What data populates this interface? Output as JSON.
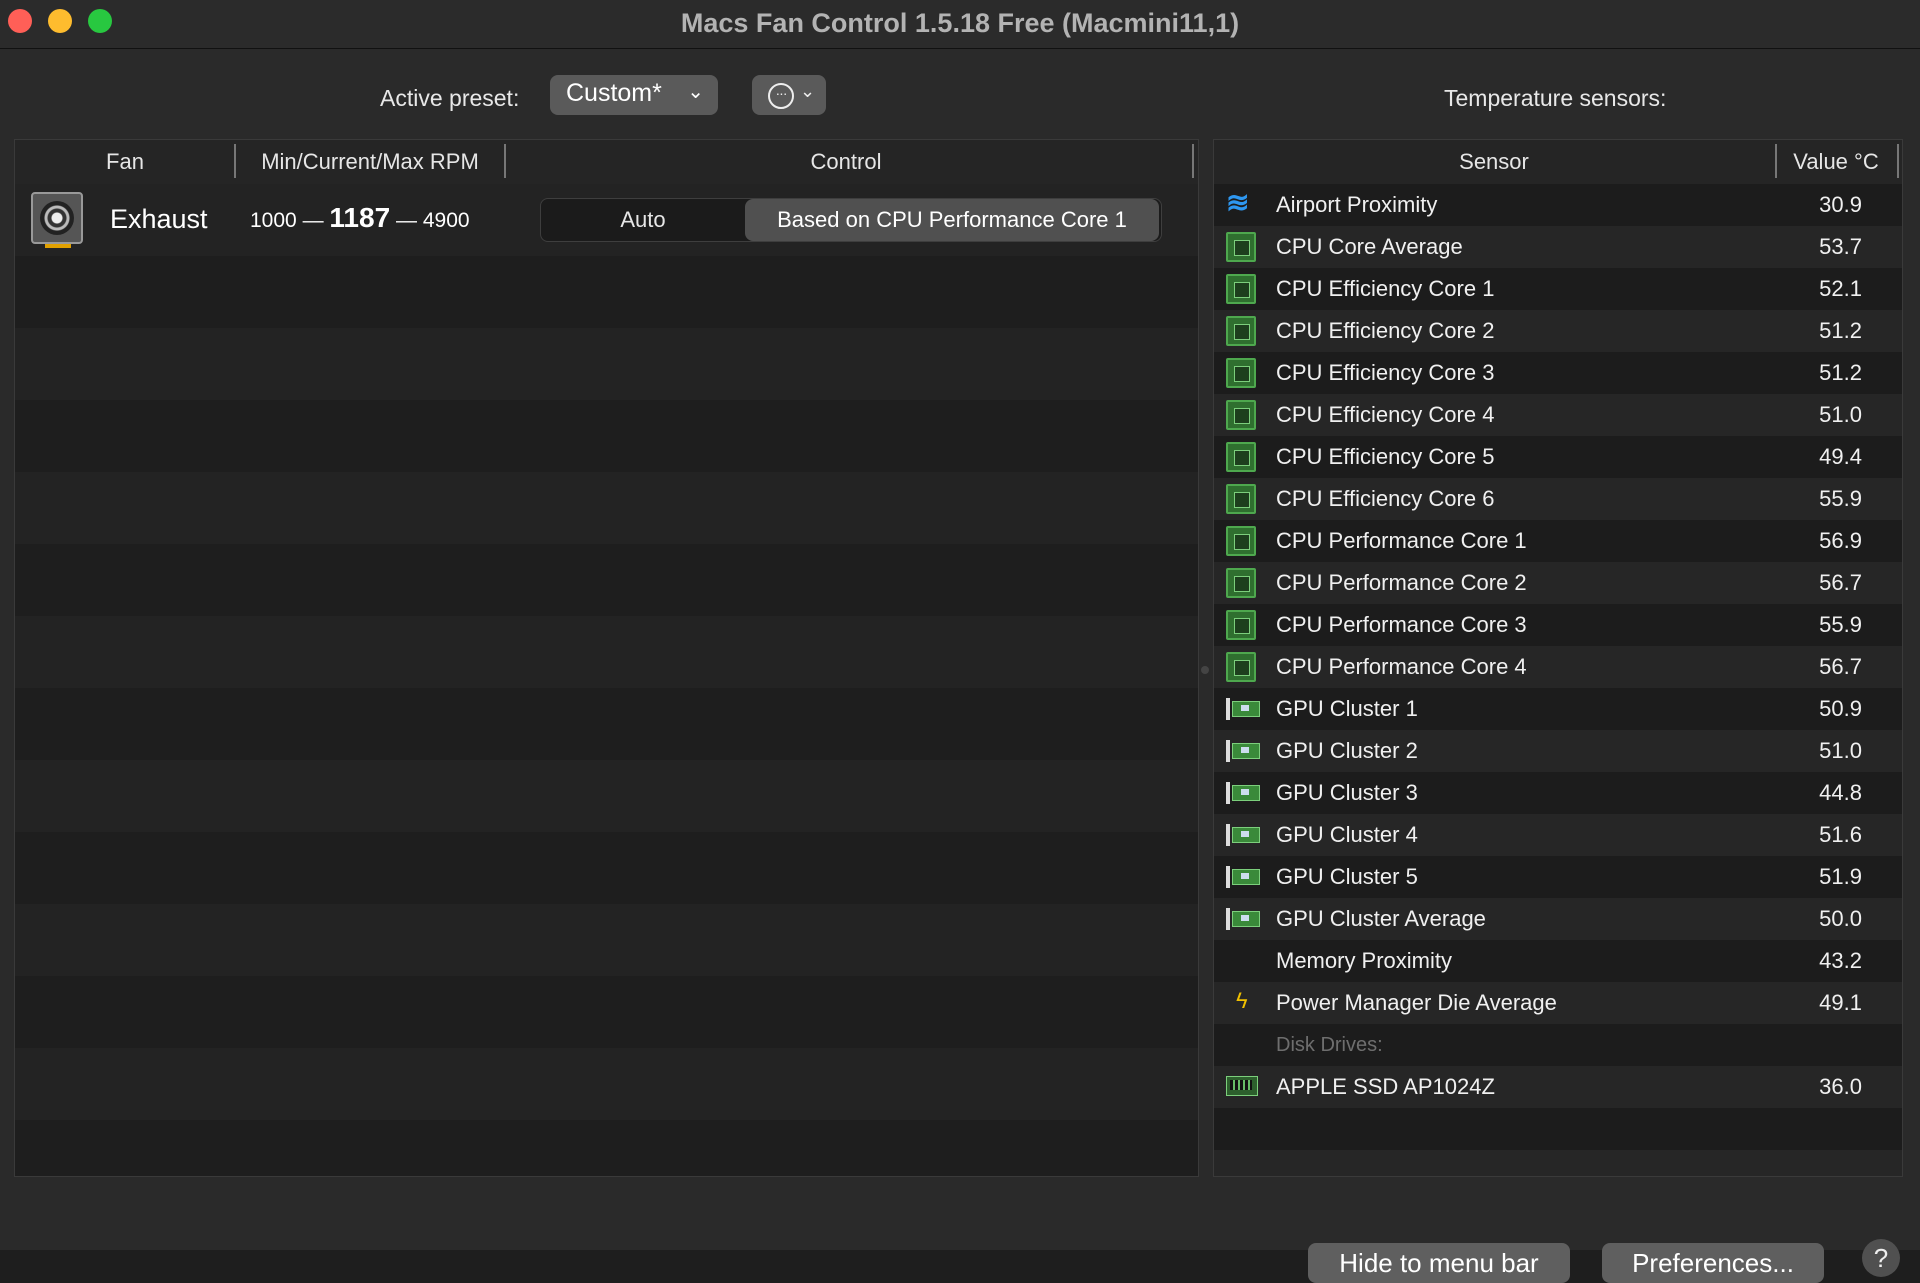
{
  "window": {
    "title": "Macs Fan Control 1.5.18 Free (Macmini11,1)"
  },
  "toolbar": {
    "preset_label": "Active preset:",
    "preset_value": "Custom*",
    "more_icon": "ellipsis-circle-icon",
    "temp_label": "Temperature sensors:"
  },
  "fan_table": {
    "headers": {
      "fan": "Fan",
      "rpm": "Min/Current/Max RPM",
      "control": "Control"
    },
    "fans": [
      {
        "name": "Exhaust",
        "min": "1000",
        "current": "1187",
        "max": "4900",
        "dash": "—",
        "control_auto": "Auto",
        "control_custom": "Based on CPU Performance Core 1",
        "selected": "custom"
      }
    ]
  },
  "sensor_table": {
    "headers": {
      "sensor": "Sensor",
      "value": "Value °C"
    },
    "rows": [
      {
        "icon": "wifi-icon",
        "name": "Airport Proximity",
        "value": "30.9"
      },
      {
        "icon": "cpu-chip-icon",
        "name": "CPU Core Average",
        "value": "53.7"
      },
      {
        "icon": "cpu-chip-icon",
        "name": "CPU Efficiency Core 1",
        "value": "52.1"
      },
      {
        "icon": "cpu-chip-icon",
        "name": "CPU Efficiency Core 2",
        "value": "51.2"
      },
      {
        "icon": "cpu-chip-icon",
        "name": "CPU Efficiency Core 3",
        "value": "51.2"
      },
      {
        "icon": "cpu-chip-icon",
        "name": "CPU Efficiency Core 4",
        "value": "51.0"
      },
      {
        "icon": "cpu-chip-icon",
        "name": "CPU Efficiency Core 5",
        "value": "49.4"
      },
      {
        "icon": "cpu-chip-icon",
        "name": "CPU Efficiency Core 6",
        "value": "55.9"
      },
      {
        "icon": "cpu-chip-icon",
        "name": "CPU Performance Core 1",
        "value": "56.9"
      },
      {
        "icon": "cpu-chip-icon",
        "name": "CPU Performance Core 2",
        "value": "56.7"
      },
      {
        "icon": "cpu-chip-icon",
        "name": "CPU Performance Core 3",
        "value": "55.9"
      },
      {
        "icon": "cpu-chip-icon",
        "name": "CPU Performance Core 4",
        "value": "56.7"
      },
      {
        "icon": "gpu-card-icon",
        "name": "GPU Cluster 1",
        "value": "50.9"
      },
      {
        "icon": "gpu-card-icon",
        "name": "GPU Cluster 2",
        "value": "51.0"
      },
      {
        "icon": "gpu-card-icon",
        "name": "GPU Cluster 3",
        "value": "44.8"
      },
      {
        "icon": "gpu-card-icon",
        "name": "GPU Cluster 4",
        "value": "51.6"
      },
      {
        "icon": "gpu-card-icon",
        "name": "GPU Cluster 5",
        "value": "51.9"
      },
      {
        "icon": "gpu-card-icon",
        "name": "GPU Cluster Average",
        "value": "50.0"
      },
      {
        "icon": "",
        "name": "Memory Proximity",
        "value": "43.2"
      },
      {
        "icon": "power-bolt-icon",
        "name": "Power Manager Die Average",
        "value": "49.1"
      },
      {
        "icon": "",
        "name": "Disk Drives:",
        "value": "",
        "group": true
      },
      {
        "icon": "ssd-icon",
        "name": "APPLE SSD AP1024Z",
        "value": "36.0"
      }
    ]
  },
  "footer": {
    "hide_label": "Hide to menu bar",
    "prefs_label": "Preferences...",
    "help_label": "?"
  }
}
